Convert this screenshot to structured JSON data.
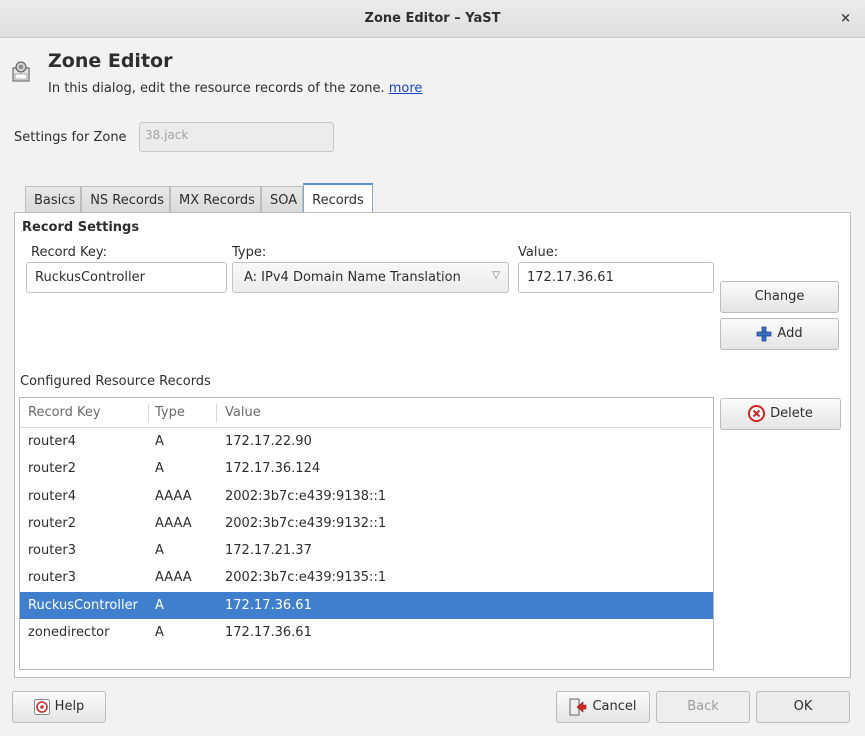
{
  "window": {
    "title": "Zone Editor – YaST",
    "close_glyph": "×"
  },
  "header": {
    "title": "Zone Editor",
    "description": "In this dialog, edit the resource records of the zone.",
    "more_link": "more",
    "icon": "zone-editor-icon"
  },
  "zone": {
    "label": "Settings for Zone",
    "value": "38.jack"
  },
  "tabs": [
    {
      "label": "Basics"
    },
    {
      "label": "NS Records"
    },
    {
      "label": "MX Records"
    },
    {
      "label": "SOA"
    },
    {
      "label": "Records"
    }
  ],
  "active_tab": "Records",
  "record_settings": {
    "title": "Record Settings",
    "key_label": "Record Key:",
    "key_value": "RuckusController",
    "type_label": "Type:",
    "type_value": "A: IPv4 Domain Name Translation",
    "value_label": "Value:",
    "value_value": "172.17.36.61"
  },
  "buttons": {
    "change": "Change",
    "add": "Add",
    "delete": "Delete"
  },
  "records": {
    "caption": "Configured Resource Records",
    "columns": [
      "Record Key",
      "Type",
      "Value"
    ],
    "rows": [
      [
        "router4",
        "A",
        "172.17.22.90"
      ],
      [
        "router2",
        "A",
        "172.17.36.124"
      ],
      [
        "router4",
        "AAAA",
        "2002:3b7c:e439:9138::1"
      ],
      [
        "router2",
        "AAAA",
        "2002:3b7c:e439:9132::1"
      ],
      [
        "router3",
        "A",
        "172.17.21.37"
      ],
      [
        "router3",
        "AAAA",
        "2002:3b7c:e439:9135::1"
      ],
      [
        "RuckusController",
        "A",
        "172.17.36.61"
      ],
      [
        "zonedirector",
        "A",
        "172.17.36.61"
      ]
    ],
    "selected_row": 6
  },
  "footer": {
    "help": "Help",
    "cancel": "Cancel",
    "back": "Back",
    "ok": "OK"
  },
  "colors": {
    "selection": "#3f7fcd",
    "accent": "#5c8fd4",
    "link": "#1a46c8",
    "delete_icon": "#d0261f",
    "add_icon": "#3a6fc4"
  }
}
